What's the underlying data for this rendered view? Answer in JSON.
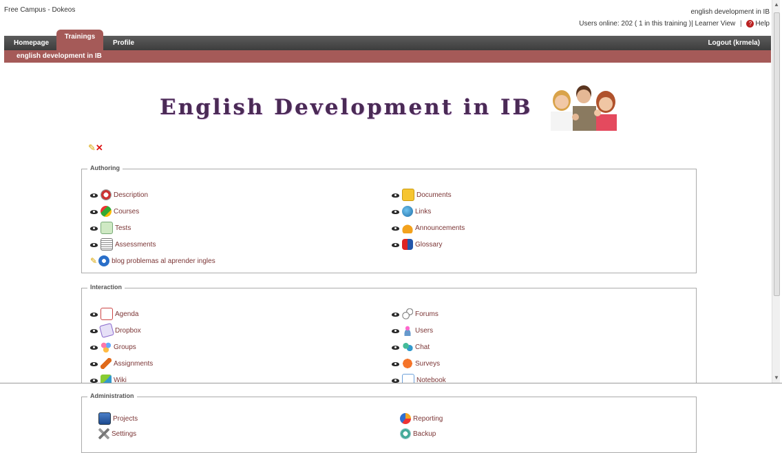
{
  "header": {
    "site_title": "Free Campus - Dokeos",
    "course_name": "english development in IB",
    "users_online": "Users online: 202",
    "in_training": "( 1 in this training )|",
    "learner_view": "Learner View",
    "help": "Help"
  },
  "nav": {
    "homepage": "Homepage",
    "trainings": "Trainings",
    "profile": "Profile",
    "logout": "Logout (krmela)"
  },
  "breadcrumb": "english development in IB",
  "banner": {
    "title": "English Development in IB"
  },
  "authoring": {
    "legend": "Authoring",
    "left": [
      "Description",
      "Courses",
      "Tests",
      "Assessments"
    ],
    "right": [
      "Documents",
      "Links",
      "Announcements",
      "Glossary"
    ],
    "extra": "blog problemas al aprender ingles"
  },
  "interaction": {
    "legend": "Interaction",
    "left": [
      "Agenda",
      "Dropbox",
      "Groups",
      "Assignments",
      "Wiki"
    ],
    "right": [
      "Forums",
      "Users",
      "Chat",
      "Surveys",
      "Notebook"
    ]
  },
  "administration": {
    "legend": "Administration",
    "left": [
      "Projects",
      "Settings"
    ],
    "right": [
      "Reporting",
      "Backup"
    ]
  },
  "colors": {
    "accent": "#a55a58",
    "link": "#7b3535",
    "navbar": "#4a4a4a"
  }
}
